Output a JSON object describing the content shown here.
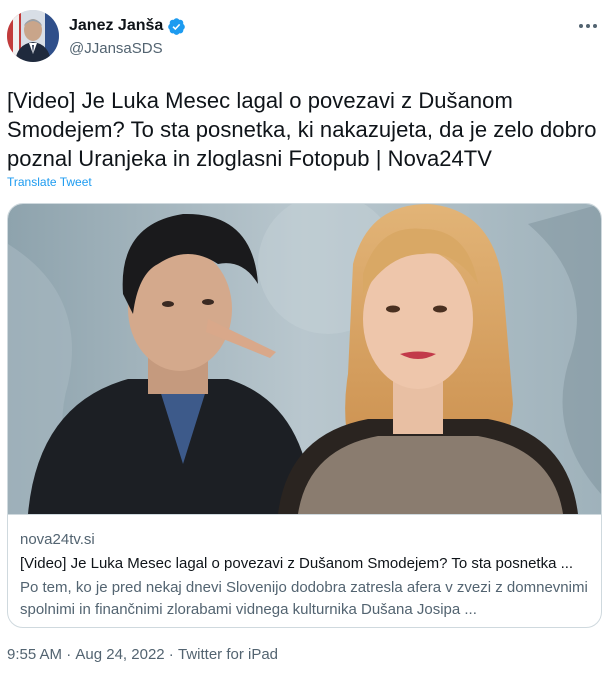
{
  "author": {
    "display_name": "Janez Janša",
    "handle": "@JJansaSDS",
    "verified_icon": "verified-badge-icon",
    "accent_color": "#1d9bf0"
  },
  "menu": {
    "icon": "more-horizontal-icon"
  },
  "tweet": {
    "text": "[Video] Je Luka Mesec lagal o povezavi z Dušanom Smodejem? To sta posnetka, ki nakazujeta, da je zelo dobro poznal Uranjeka in zloglasni Fotopub | Nova24TV",
    "translate_label": "Translate Tweet"
  },
  "card": {
    "domain": "nova24tv.si",
    "title": "[Video] Je Luka Mesec lagal o povezavi z Dušanom Smodejem? To sta posnetka ...",
    "description": "Po tem, ko je pred nekaj dnevi Slovenijo dodobra zatresla afera v zvezi z domnevnimi spolnimi in finančnimi zlorabami vidnega kulturnika Dušana Josipa ..."
  },
  "footer": {
    "time": "9:55 AM",
    "separator": " · ",
    "date": "Aug 24, 2022",
    "source": "Twitter for iPad"
  }
}
